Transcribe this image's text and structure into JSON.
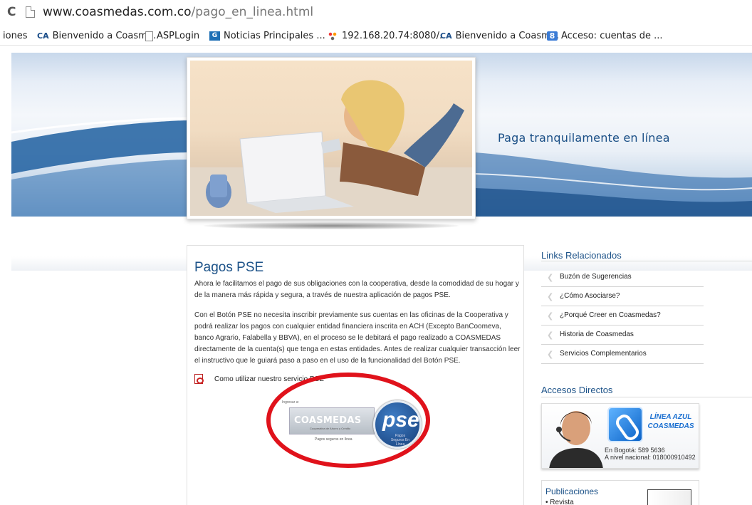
{
  "browser": {
    "url_domain": "www.coasmedas.com.co",
    "url_path": "/pago_en_linea.html",
    "bookmarks": [
      {
        "label": "iones",
        "icon": "none"
      },
      {
        "label": "Bienvenido a Coasm...",
        "icon": "coasmedas-icon"
      },
      {
        "label": "ASPLogin",
        "icon": "page-icon"
      },
      {
        "label": "Noticias Principales ...",
        "icon": "news-icon"
      },
      {
        "label": "192.168.20.74:8080/...",
        "icon": "dots-icon"
      },
      {
        "label": "Bienvenido a Coasm...",
        "icon": "coasmedas-icon"
      },
      {
        "label": "Acceso: cuentas de ...",
        "icon": "google-icon"
      }
    ]
  },
  "banner": {
    "headline": "Paga tranquilamente en línea"
  },
  "main": {
    "title": "Pagos PSE",
    "paragraph1": "Ahora le facilitamos el pago de sus obligaciones con la cooperativa, desde la comodidad de su hogar y de la manera más rápida y segura, a través de nuestra aplicación de pagos PSE.",
    "paragraph2": "Con el Botón PSE no necesita inscribir previamente sus cuentas en las oficinas de la Cooperativa y podrá realizar los pagos con cualquier entidad financiera inscrita en ACH (Excepto BanCoomeva, banco Agrario, Falabella y BBVA), en el proceso se le debitará el pago realizado a COASMEDAS directamente de la cuenta(s) que tenga en estas entidades. Antes de realizar cualquier transacción leer el instructivo que le guiará paso a paso en el uso de la funcionalidad del Botón PSE.",
    "pdf_link": "Como utilizar nuestro servicio PSE",
    "pse_button": {
      "ingresar": "Ingresar a:",
      "brand": "COASMEDAS",
      "brand_sub": "Cooperativa de Ahorro y Crédito",
      "caption": "Pagos seguros en línea",
      "pse": "pse",
      "pse_sub": "Pagos Seguros En Línea"
    }
  },
  "sidebar": {
    "links_title": "Links Relacionados",
    "links": [
      "Buzón de Sugerencias",
      "¿Cómo Asociarse?",
      "¿Porqué Creer en Coasmedas?",
      "Historia de Coasmedas",
      "Servicios Complementarios"
    ],
    "accesos_title": "Accesos Directos",
    "linea_azul": {
      "title_line1": "LÍNEA AZUL",
      "title_line2": "COASMEDAS",
      "bogota": "En Bogotá: 589 5636",
      "nacional": "A nivel nacional: 018000910492"
    },
    "publicaciones_title": "Publicaciones",
    "publicaciones_item": "Revista"
  },
  "colors": {
    "accent": "#1c5288",
    "highlight_ring": "#e0121b"
  }
}
